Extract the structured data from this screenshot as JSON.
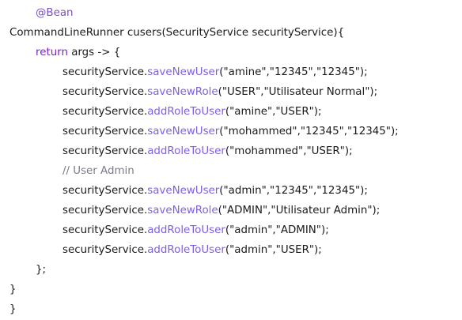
{
  "colors": {
    "text": "#1a1a1a",
    "annotation": "#7a4ec0",
    "keyword": "#7c1fd1",
    "method": "#7f5fe0",
    "comment": "#7a7a8a"
  },
  "code": {
    "lines": [
      {
        "indent": 1,
        "tokens": [
          {
            "text": "@Bean",
            "kind": "annotation"
          }
        ]
      },
      {
        "indent": 0,
        "tokens": [
          {
            "text": "CommandLineRunner cusers(SecurityService securityService){",
            "kind": "plain"
          }
        ]
      },
      {
        "indent": 1,
        "tokens": [
          {
            "text": "return",
            "kind": "keyword"
          },
          {
            "text": " args -> {",
            "kind": "plain"
          }
        ]
      },
      {
        "indent": 2,
        "tokens": [
          {
            "text": "securityService.",
            "kind": "plain"
          },
          {
            "text": "saveNewUser",
            "kind": "method"
          },
          {
            "text": "(\"amine\",\"12345\",\"12345\");",
            "kind": "plain"
          }
        ]
      },
      {
        "indent": 2,
        "tokens": [
          {
            "text": "securityService.",
            "kind": "plain"
          },
          {
            "text": "saveNewRole",
            "kind": "method"
          },
          {
            "text": "(\"USER\",\"Utilisateur Normal\");",
            "kind": "plain"
          }
        ]
      },
      {
        "indent": 2,
        "tokens": [
          {
            "text": "securityService.",
            "kind": "plain"
          },
          {
            "text": "addRoleToUser",
            "kind": "method"
          },
          {
            "text": "(\"amine\",\"USER\");",
            "kind": "plain"
          }
        ]
      },
      {
        "indent": 2,
        "tokens": [
          {
            "text": "securityService.",
            "kind": "plain"
          },
          {
            "text": "saveNewUser",
            "kind": "method"
          },
          {
            "text": "(\"mohammed\",\"12345\",\"12345\");",
            "kind": "plain"
          }
        ]
      },
      {
        "indent": 2,
        "tokens": [
          {
            "text": "securityService.",
            "kind": "plain"
          },
          {
            "text": "addRoleToUser",
            "kind": "method"
          },
          {
            "text": "(\"mohammed\",\"USER\");",
            "kind": "plain"
          }
        ]
      },
      {
        "indent": 2,
        "tokens": [
          {
            "text": "// User Admin",
            "kind": "comment"
          }
        ]
      },
      {
        "indent": 2,
        "tokens": [
          {
            "text": "securityService.",
            "kind": "plain"
          },
          {
            "text": "saveNewUser",
            "kind": "method"
          },
          {
            "text": "(\"admin\",\"12345\",\"12345\");",
            "kind": "plain"
          }
        ]
      },
      {
        "indent": 2,
        "tokens": [
          {
            "text": "securityService.",
            "kind": "plain"
          },
          {
            "text": "saveNewRole",
            "kind": "method"
          },
          {
            "text": "(\"ADMIN\",\"Utilisateur Admin\");",
            "kind": "plain"
          }
        ]
      },
      {
        "indent": 2,
        "tokens": [
          {
            "text": "securityService.",
            "kind": "plain"
          },
          {
            "text": "addRoleToUser",
            "kind": "method"
          },
          {
            "text": "(\"admin\",\"ADMIN\");",
            "kind": "plain"
          }
        ]
      },
      {
        "indent": 2,
        "tokens": [
          {
            "text": "securityService.",
            "kind": "plain"
          },
          {
            "text": "addRoleToUser",
            "kind": "method"
          },
          {
            "text": "(\"admin\",\"USER\");",
            "kind": "plain"
          }
        ]
      },
      {
        "indent": 1,
        "tokens": [
          {
            "text": "};",
            "kind": "plain"
          }
        ]
      },
      {
        "indent": 0,
        "tokens": [
          {
            "text": "}",
            "kind": "plain"
          }
        ]
      },
      {
        "indent": 0,
        "tokens": [
          {
            "text": "}",
            "kind": "plain"
          }
        ]
      }
    ]
  }
}
